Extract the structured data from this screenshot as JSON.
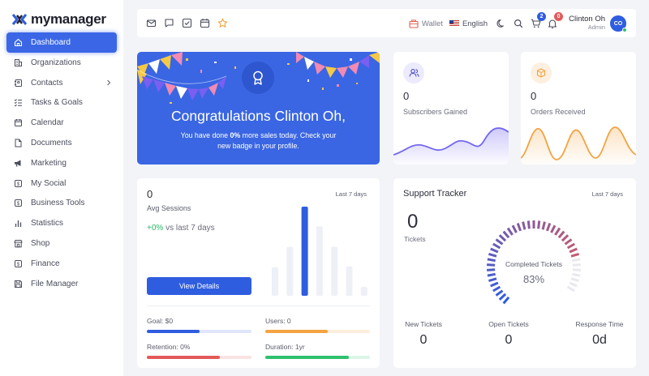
{
  "brand": {
    "name": "mymanager"
  },
  "sidebar": {
    "items": [
      {
        "label": "Dashboard",
        "icon": "home-icon",
        "active": true
      },
      {
        "label": "Organizations",
        "icon": "building-icon"
      },
      {
        "label": "Contacts",
        "icon": "contacts-icon",
        "has_children": true
      },
      {
        "label": "Tasks & Goals",
        "icon": "tasks-icon"
      },
      {
        "label": "Calendar",
        "icon": "calendar-icon"
      },
      {
        "label": "Documents",
        "icon": "document-icon"
      },
      {
        "label": "Marketing",
        "icon": "megaphone-icon"
      },
      {
        "label": "My Social",
        "icon": "social-icon"
      },
      {
        "label": "Business Tools",
        "icon": "briefcase-icon"
      },
      {
        "label": "Statistics",
        "icon": "bar-chart-icon"
      },
      {
        "label": "Shop",
        "icon": "shop-icon"
      },
      {
        "label": "Finance",
        "icon": "finance-icon"
      },
      {
        "label": "File Manager",
        "icon": "save-icon"
      }
    ]
  },
  "topbar": {
    "quick_icons": [
      "mail-icon",
      "chat-icon",
      "checkbox-icon",
      "calendar-icon",
      "star-icon"
    ],
    "wallet_label": "Wallet",
    "language": "English",
    "cart_count": "2",
    "notification_count": "0",
    "user_name": "Clinton Oh",
    "user_role": "Admin",
    "avatar_initials": "CO"
  },
  "congrats": {
    "title": "Congratulations Clinton Oh,",
    "line1_pre": "You have done ",
    "line1_bold": "0%",
    "line1_post": " more sales today. Check your",
    "line2": "new badge in your profile."
  },
  "stats": {
    "subscribers": {
      "value": "0",
      "label": "Subscribers Gained",
      "color": "#7367f0"
    },
    "orders": {
      "value": "0",
      "label": "Orders Received",
      "color": "#f4a340"
    }
  },
  "sessions": {
    "value": "0",
    "period": "Last 7 days",
    "label": "Avg Sessions",
    "growth": "+0%",
    "growth_text": " vs last 7 days",
    "button": "View Details",
    "bar_levels": [
      0.32,
      0.55,
      1.0,
      0.78,
      0.55,
      0.33,
      0.1
    ],
    "metrics": [
      {
        "label": "Goal: $0",
        "fill": 0.5,
        "color": "#2f5de0",
        "track": "#dfe6fb"
      },
      {
        "label": "Users: 0",
        "fill": 0.6,
        "color": "#f4a340",
        "track": "#fdeedc"
      },
      {
        "label": "Retention: 0%",
        "fill": 0.7,
        "color": "#e35a5a",
        "track": "#fbe3e3"
      },
      {
        "label": "Duration: 1yr",
        "fill": 0.8,
        "color": "#2fc06e",
        "track": "#dcf5e7"
      }
    ]
  },
  "support": {
    "title": "Support Tracker",
    "period": "Last 7 days",
    "tickets_value": "0",
    "tickets_label": "Tickets",
    "gauge_label": "Completed Tickets",
    "gauge_value": "83%",
    "gauge_fraction": 0.83,
    "columns": [
      {
        "label": "New Tickets",
        "value": "0"
      },
      {
        "label": "Open Tickets",
        "value": "0"
      },
      {
        "label": "Response Time",
        "value": "0d"
      }
    ]
  }
}
